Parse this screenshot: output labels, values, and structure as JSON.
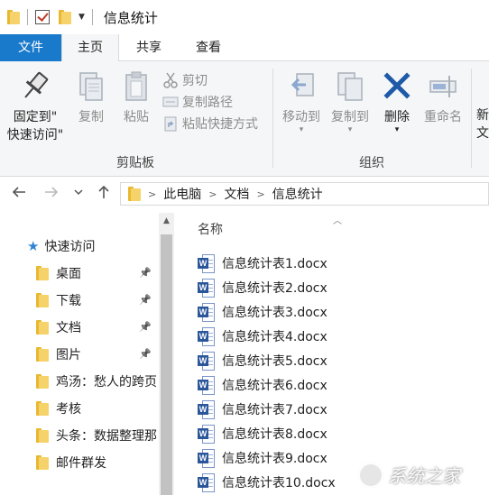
{
  "window": {
    "title": "信息统计"
  },
  "ribbon_tabs": [
    "文件",
    "主页",
    "共享",
    "查看"
  ],
  "clipboard": {
    "pin_label_1": "固定到\"",
    "pin_label_2": "快速访问\"",
    "copy": "复制",
    "paste": "粘贴",
    "cut": "剪切",
    "copy_path": "复制路径",
    "paste_shortcut": "粘贴快捷方式",
    "group": "剪贴板"
  },
  "organize": {
    "move_to": "移动到",
    "copy_to": "复制到",
    "delete": "删除",
    "rename": "重命名",
    "group": "组织"
  },
  "new": {
    "new_partial_1": "新",
    "new_partial_2": "文"
  },
  "address": {
    "crumbs": [
      "此电脑",
      "文档",
      "信息统计"
    ]
  },
  "nav_pane": {
    "quick_access": "快速访问",
    "items": [
      {
        "label": "桌面",
        "icon": "desktop-folder-icon",
        "pinned": true
      },
      {
        "label": "下载",
        "icon": "download-folder-icon",
        "pinned": true
      },
      {
        "label": "文档",
        "icon": "documents-folder-icon",
        "pinned": true
      },
      {
        "label": "图片",
        "icon": "pictures-folder-icon",
        "pinned": true
      },
      {
        "label": "鸡汤：愁人的跨页",
        "icon": "folder-icon",
        "pinned": false
      },
      {
        "label": "考核",
        "icon": "folder-icon",
        "pinned": false
      },
      {
        "label": "头条：数据整理那",
        "icon": "folder-icon",
        "pinned": false
      },
      {
        "label": "邮件群发",
        "icon": "folder-icon",
        "pinned": false
      }
    ]
  },
  "file_list": {
    "column_name": "名称",
    "files": [
      "信息统计表1.docx",
      "信息统计表2.docx",
      "信息统计表3.docx",
      "信息统计表4.docx",
      "信息统计表5.docx",
      "信息统计表6.docx",
      "信息统计表7.docx",
      "信息统计表8.docx",
      "信息统计表9.docx",
      "信息统计表10.docx"
    ]
  },
  "watermark": {
    "text": "系统之家"
  },
  "colors": {
    "file_tab": "#1979ca",
    "folder": "#f6d36a",
    "word": "#2b579a",
    "delete_x": "#1e5aa8"
  }
}
